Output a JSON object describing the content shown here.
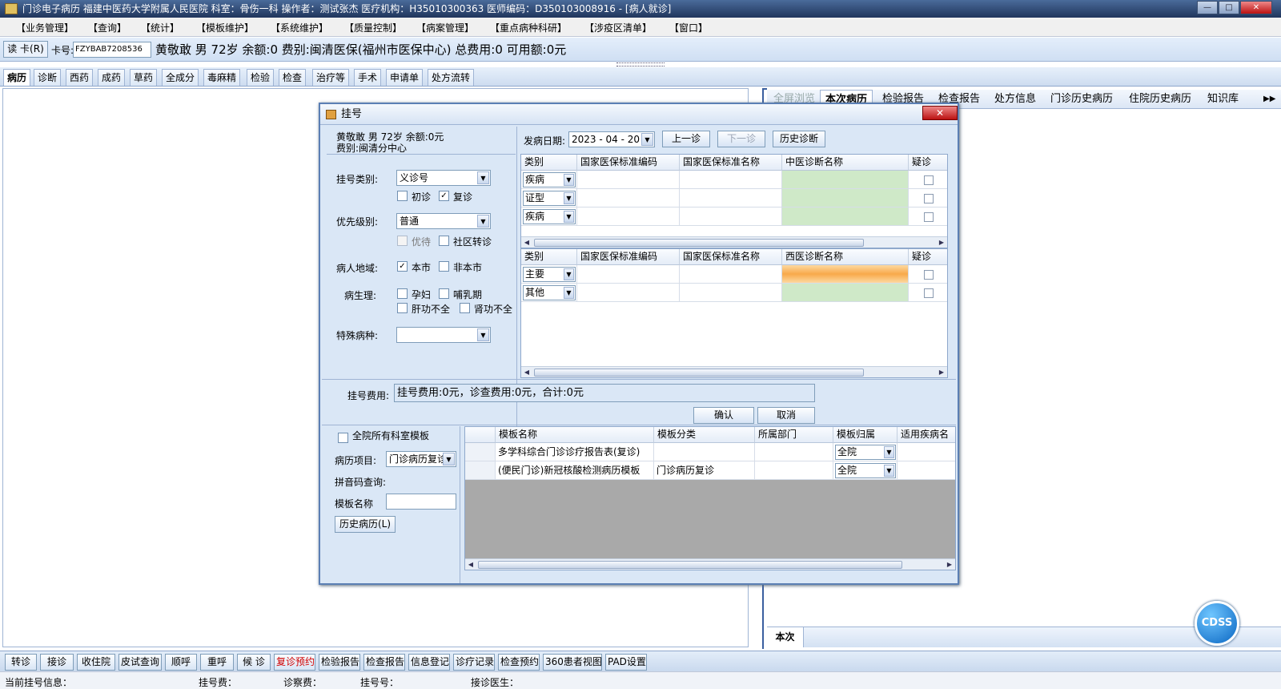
{
  "window": {
    "title": "门诊电子病历  福建中医药大学附属人民医院  科室：骨伤一科  操作者：测试张杰  医疗机构：H35010300363  医师编码：D350103008916 - [病人就诊]",
    "min": "—",
    "max": "□",
    "close": "✕"
  },
  "menu": [
    "【业务管理】",
    "【查询】",
    "【统计】",
    "【模板维护】",
    "【系统维护】",
    "【质量控制】",
    "【病案管理】",
    "【重点病种科研】",
    "【涉疫区清单】",
    "【窗口】"
  ],
  "patient_bar": {
    "read_card": "读 卡(R)",
    "card_label": "卡号:",
    "card_no": "FZYBAB7208536",
    "info": "黄敬敢  男  72岁  余额:0  费别:闽清医保(福州市医保中心)  总费用:0  可用额:0元"
  },
  "tabs": [
    "病历",
    "诊断",
    "西药",
    "成药",
    "草药",
    "全成分",
    "毒麻精",
    "检验",
    "检查",
    "治疗等",
    "手术",
    "申请单",
    "处方流转"
  ],
  "active_tab": "病历",
  "right_tabs": [
    "全屏浏览",
    "本次病历",
    "检验报告",
    "检查报告",
    "处方信息",
    "门诊历史病历",
    "住院历史病历",
    "知识库"
  ],
  "right_tabs_more": "▶▶",
  "right_bottom_tab": "本次",
  "cdss": "CDSS",
  "bottom_buttons": [
    "转诊",
    "接诊",
    "收住院",
    "皮试查询",
    "顺呼",
    "重呼",
    "候 诊",
    "复诊预约",
    "检验报告",
    "检查报告",
    "信息登记",
    "诊疗记录",
    "检查预约",
    "360患者视图",
    "PAD设置"
  ],
  "status": {
    "current_reg": "当前挂号信息：",
    "reg_fee": "挂号费：",
    "diag_fee": "诊察费：",
    "reg_no": "挂号号：",
    "doctor": "接诊医生："
  },
  "dialog": {
    "title": "挂号",
    "close": "✕",
    "patient_line1": "黄敬敢  男  72岁  余额:0元",
    "patient_line2": "费别:闽清分中心",
    "reg_type_label": "挂号类别:",
    "reg_type_value": "义诊号",
    "first_visit": "初诊",
    "return_visit": "复诊",
    "priority_label": "优先级别:",
    "priority_value": "普通",
    "priority_opt1": "优待",
    "priority_opt2": "社区转诊",
    "region_label": "病人地域:",
    "region_local": "本市",
    "region_nonlocal": "非本市",
    "physio_label": "病生理:",
    "physio_pregnant": "孕妇",
    "physio_lactation": "哺乳期",
    "physio_liver": "肝功不全",
    "physio_kidney": "肾功不全",
    "special_label": "特殊病种:",
    "special_value": "",
    "onset_label": "发病日期:",
    "onset_date": "2023 - 04 - 20",
    "prev_btn": "上一诊",
    "next_btn": "下一诊",
    "history_diag_btn": "历史诊断",
    "tcm_grid": {
      "headers": [
        "类别",
        "国家医保标准编码",
        "国家医保标准名称",
        "中医诊断名称",
        "疑诊"
      ],
      "rows": [
        {
          "type": "疾病",
          "code": "",
          "name": "",
          "diag": ""
        },
        {
          "type": "证型",
          "code": "",
          "name": "",
          "diag": ""
        },
        {
          "type": "疾病",
          "code": "",
          "name": "",
          "diag": ""
        }
      ]
    },
    "wm_grid": {
      "headers": [
        "类别",
        "国家医保标准编码",
        "国家医保标准名称",
        "西医诊断名称",
        "疑诊"
      ],
      "rows": [
        {
          "type": "主要",
          "code": "",
          "name": "",
          "diag": ""
        },
        {
          "type": "其他",
          "code": "",
          "name": "",
          "diag": ""
        }
      ]
    },
    "fee_label": "挂号费用:",
    "fee_text": "挂号费用:0元，诊查费用:0元，合计:0元",
    "confirm_btn": "确认",
    "cancel_btn": "取消",
    "all_dept_templates": "全院所有科室模板",
    "record_item_label": "病历项目:",
    "record_item_value": "门诊病历复诊",
    "pinyin_label": "拼音码查询:",
    "template_name_label": "模板名称",
    "history_record_btn": "历史病历(L)",
    "template_grid": {
      "headers": [
        "模板名称",
        "模板分类",
        "所属部门",
        "模板归属",
        "适用疾病名"
      ],
      "rows": [
        {
          "name": "多学科综合门诊诊疗报告表(复诊)",
          "category": "",
          "dept": "",
          "owner": "全院"
        },
        {
          "name": "(便民门诊)新冠核酸检测病历模板",
          "category": "门诊病历复诊",
          "dept": "",
          "owner": "全院"
        }
      ]
    }
  },
  "colors": {
    "accent": "#3a5f9f",
    "tcm_cell": "#cfe9c8",
    "wm_primary_cell": "#f8a94a",
    "disabled_grid_bg": "#a9a9a9",
    "red_button": "#d00000"
  }
}
